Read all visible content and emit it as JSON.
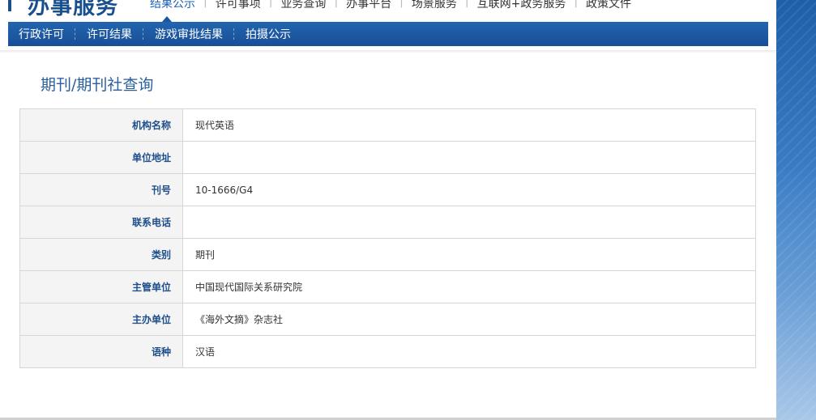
{
  "header": {
    "logo_text": "办事服务",
    "top_nav": [
      {
        "label": "结果公示",
        "active": true
      },
      {
        "label": "许可事项",
        "active": false
      },
      {
        "label": "业务查询",
        "active": false
      },
      {
        "label": "办事平台",
        "active": false
      },
      {
        "label": "场景服务",
        "active": false
      },
      {
        "label": "互联网+政务服务",
        "active": false
      },
      {
        "label": "政策文件",
        "active": false
      }
    ]
  },
  "subnav": {
    "items": [
      "行政许可",
      "许可结果",
      "游戏审批结果",
      "拍摄公示"
    ]
  },
  "page": {
    "title": "期刊/期刊社查询"
  },
  "details": [
    {
      "label": "机构名称",
      "value": "现代英语"
    },
    {
      "label": "单位地址",
      "value": ""
    },
    {
      "label": "刊号",
      "value": "10-1666/G4"
    },
    {
      "label": "联系电话",
      "value": ""
    },
    {
      "label": "类别",
      "value": "期刊"
    },
    {
      "label": "主管单位",
      "value": "中国现代国际关系研究院"
    },
    {
      "label": "主办单位",
      "value": "《海外文摘》杂志社"
    },
    {
      "label": "语种",
      "value": "汉语"
    }
  ],
  "colors": {
    "brand_blue": "#1a4f8e",
    "nav_blue": "#184f96",
    "title_blue": "#2a5f9e"
  }
}
